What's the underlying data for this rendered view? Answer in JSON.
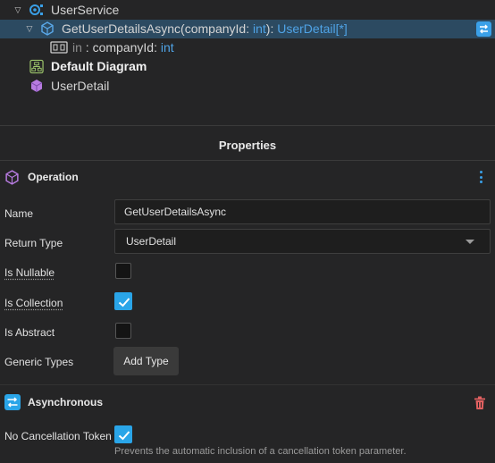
{
  "tree": {
    "service": {
      "name": "UserService"
    },
    "operation": {
      "name": "GetUserDetailsAsync",
      "open_paren": "(",
      "param_name": "companyId",
      "colon": ": ",
      "param_type": "int",
      "close_paren": "):",
      "return_type": "UserDetail[*]"
    },
    "parameter": {
      "direction": "in",
      "sep": " : ",
      "name": "companyId",
      "colon": ": ",
      "type": "int"
    },
    "diagram": {
      "name": "Default Diagram"
    },
    "dto": {
      "name": "UserDetail"
    }
  },
  "properties": {
    "title": "Properties",
    "operation_section": {
      "title": "Operation",
      "name_label": "Name",
      "name_value": "GetUserDetailsAsync",
      "return_type_label": "Return Type",
      "return_type_value": "UserDetail",
      "is_nullable_label": "Is Nullable",
      "is_nullable": false,
      "is_collection_label": "Is Collection",
      "is_collection": true,
      "is_abstract_label": "Is Abstract",
      "is_abstract": false,
      "generic_types_label": "Generic Types",
      "add_type_label": "Add Type"
    },
    "async_section": {
      "title": "Asynchronous",
      "no_cancel_label": "No Cancellation Token",
      "no_cancel": true,
      "no_cancel_hint": "Prevents the automatic inclusion of a cancellation token parameter."
    }
  },
  "colors": {
    "accent": "#2aa5e8",
    "selection": "#2c4a61",
    "type_keyword": "#4fa3e6",
    "delete": "#e06060",
    "dto_icon": "#b77be0"
  },
  "icons": [
    "chevron-down-icon",
    "service-icon",
    "operation-icon",
    "parameter-icon",
    "diagram-icon",
    "dto-icon",
    "sync-icon",
    "kebab-menu-icon",
    "async-icon",
    "trash-icon",
    "checkmark-icon",
    "dropdown-caret-icon"
  ]
}
